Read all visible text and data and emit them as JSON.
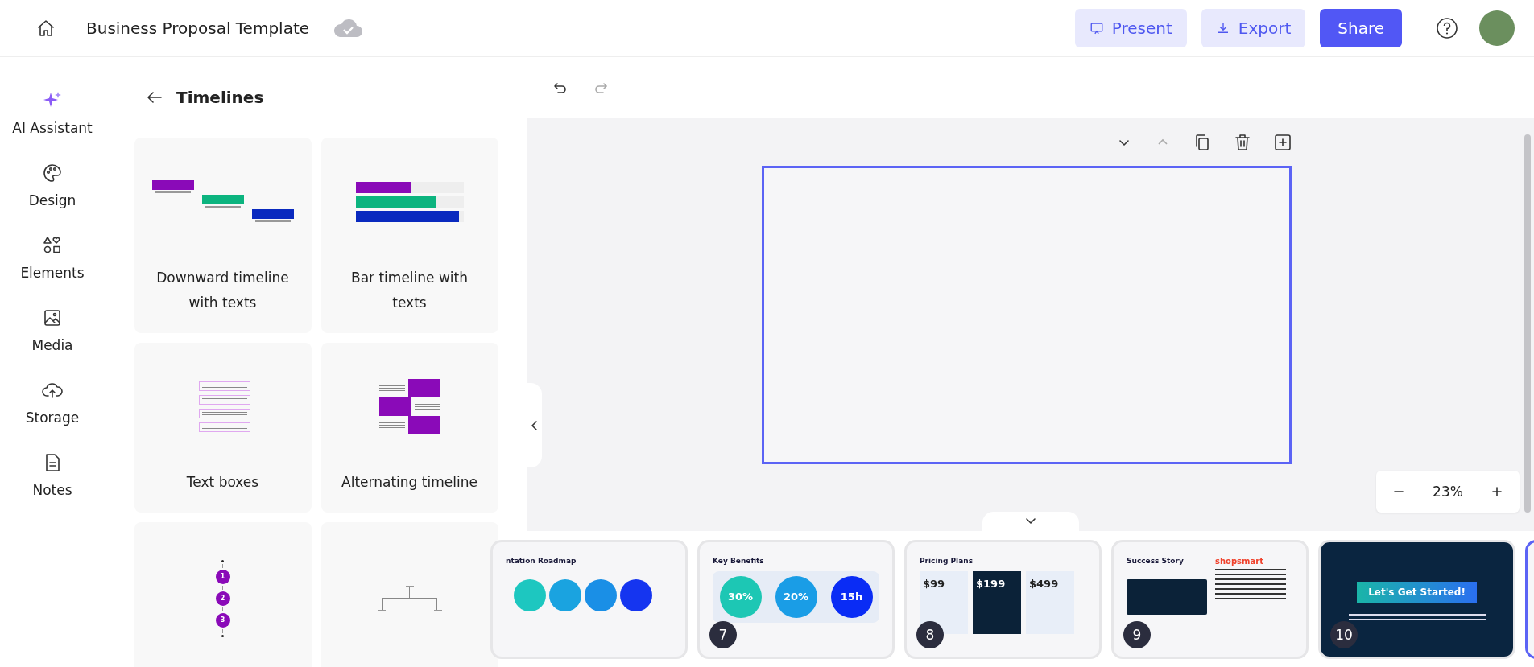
{
  "header": {
    "title": "Business Proposal Template",
    "buttons": [
      {
        "label": "Present",
        "kind": "present"
      },
      {
        "label": "Export",
        "kind": "export"
      },
      {
        "label": "Share",
        "kind": "share"
      }
    ]
  },
  "rail": [
    {
      "label": "AI Assistant",
      "kind": "sparkle"
    },
    {
      "label": "Design",
      "kind": "palette"
    },
    {
      "label": "Elements",
      "kind": "shapes"
    },
    {
      "label": "Media",
      "kind": "image"
    },
    {
      "label": "Storage",
      "kind": "cloud"
    },
    {
      "label": "Notes",
      "kind": "note"
    }
  ],
  "panel": {
    "title": "Timelines",
    "templates": [
      {
        "label": "Downward timeline with texts",
        "kind": "downward"
      },
      {
        "label": "Bar timeline with texts",
        "kind": "bars"
      },
      {
        "label": "Text boxes",
        "kind": "boxes"
      },
      {
        "label": "Alternating timeline",
        "kind": "alternating"
      },
      {
        "kind": "vertical",
        "markers": [
          "1",
          "2",
          "3"
        ]
      },
      {
        "kind": "numbers"
      }
    ]
  },
  "zoom": {
    "value": "23%"
  },
  "slides": [
    {
      "kind": "roadmap",
      "title": "ntation Roadmap",
      "selected": false
    },
    {
      "kind": "benefits",
      "number": "7",
      "title": "Key Benefits",
      "stats": [
        "30%",
        "20%",
        "15h"
      ],
      "selected": false
    },
    {
      "kind": "pricing",
      "number": "8",
      "title": "Pricing Plans",
      "prices": [
        "$99",
        "$199",
        "$499"
      ],
      "selected": false
    },
    {
      "kind": "story",
      "number": "9",
      "title": "Success Story",
      "brand": "shopsmart",
      "selected": false
    },
    {
      "kind": "cta",
      "number": "10",
      "title": "Let's Get Started!",
      "selected": false
    },
    {
      "kind": "blank",
      "selected": true
    }
  ]
}
